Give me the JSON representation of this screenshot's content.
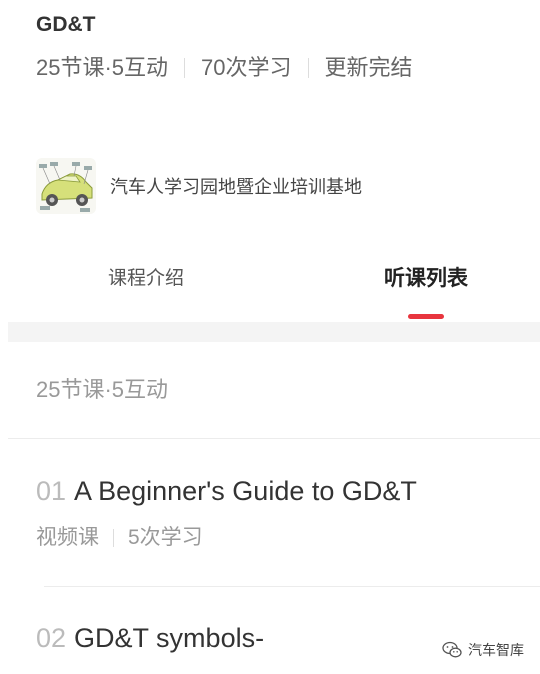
{
  "course": {
    "title": "GD&T",
    "meta": [
      "25节课·5互动",
      "70次学习",
      "更新完结"
    ]
  },
  "organization": {
    "name": "汽车人学习园地暨企业培训基地",
    "logo_icon": "car-parts-diagram-icon"
  },
  "tabs": [
    {
      "label": "课程介绍",
      "active": false
    },
    {
      "label": "听课列表",
      "active": true
    }
  ],
  "list": {
    "summary": "25节课·5互动",
    "lessons": [
      {
        "number": "01",
        "title": "A Beginner's Guide to GD&T",
        "type": "视频课",
        "views": "5次学习"
      },
      {
        "number": "02",
        "title": "GD&T symbols-",
        "type": "",
        "views": ""
      }
    ]
  },
  "watermark": {
    "text": "汽车智库",
    "icon": "wechat-icon"
  },
  "colors": {
    "accent": "#e8353e",
    "text_primary": "#333333",
    "text_muted": "#999999",
    "band": "#f4f4f4"
  }
}
